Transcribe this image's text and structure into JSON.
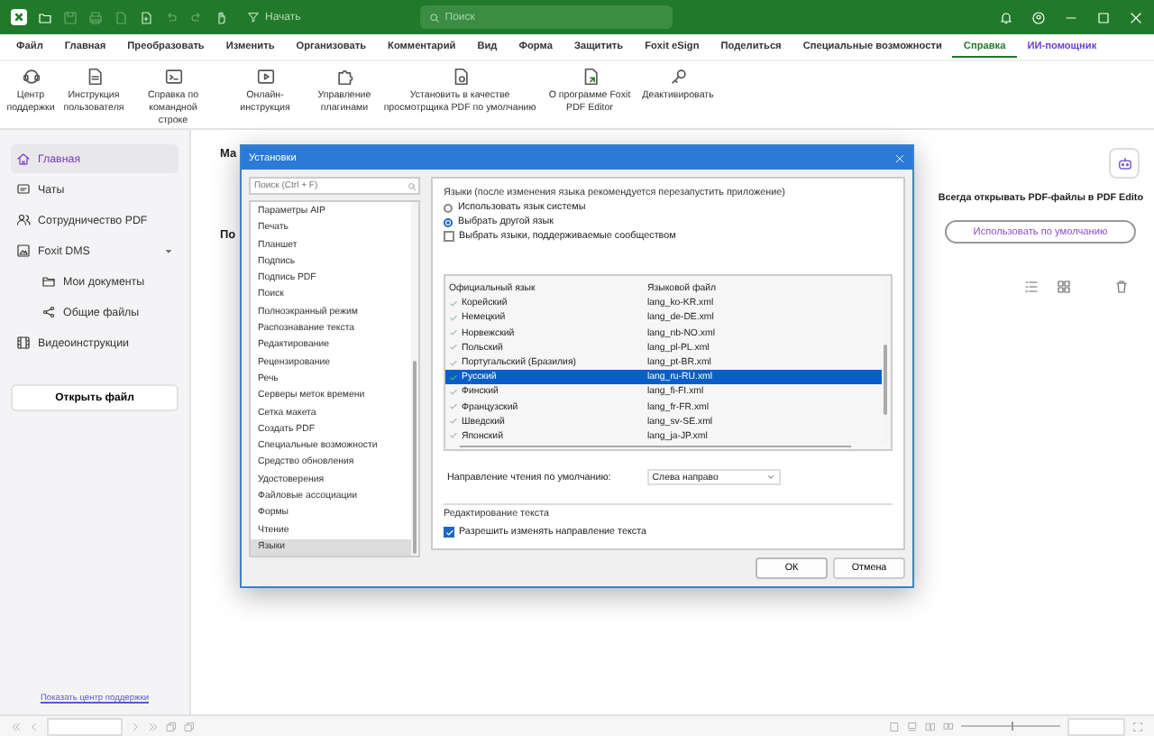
{
  "title_bar": {
    "start_label": "Начать",
    "search": {
      "placeholder": "Поиск"
    }
  },
  "menu_tabs": [
    {
      "label": "Файл",
      "selected": false,
      "kind": "menu"
    },
    {
      "label": "Главная",
      "selected": false,
      "kind": "menu"
    },
    {
      "label": "Преобразовать",
      "selected": false,
      "kind": "menu"
    },
    {
      "label": "Изменить",
      "selected": false,
      "kind": "menu"
    },
    {
      "label": "Организовать",
      "selected": false,
      "kind": "menu"
    },
    {
      "label": "Комментарий",
      "selected": false,
      "kind": "menu"
    },
    {
      "label": "Вид",
      "selected": false,
      "kind": "menu"
    },
    {
      "label": "Форма",
      "selected": false,
      "kind": "menu"
    },
    {
      "label": "Защитить",
      "selected": false,
      "kind": "menu"
    },
    {
      "label": "Foxit eSign",
      "selected": false,
      "kind": "menu"
    },
    {
      "label": "Поделиться",
      "selected": false,
      "kind": "menu"
    },
    {
      "label": "Специальные возможности",
      "selected": false,
      "kind": "menu"
    },
    {
      "label": "Справка",
      "selected": true,
      "kind": "menu"
    },
    {
      "label": "ИИ-помощник",
      "selected": false,
      "kind": "assistant"
    }
  ],
  "ribbon": [
    {
      "label": "Центр поддержки"
    },
    {
      "label": "Инструкция пользователя"
    },
    {
      "label": "Справка по командной строке"
    },
    {
      "label": "Онлайн-инструкция"
    },
    {
      "label": "Управление плагинами"
    },
    {
      "label": "Установить в качестве просмотрщика PDF по умолчанию"
    },
    {
      "label": "О программе Foxit PDF Editor"
    },
    {
      "label": "Деактивировать"
    }
  ],
  "sidebar": {
    "items": [
      {
        "label": "Главная",
        "selected": true
      },
      {
        "label": "Чаты",
        "selected": false
      },
      {
        "label": "Сотрудничество PDF",
        "selected": false
      },
      {
        "label": "Foxit DMS",
        "selected": false,
        "expanded": true,
        "children": [
          {
            "label": "Мои документы",
            "selected": false
          },
          {
            "label": "Общие файлы",
            "selected": false
          }
        ]
      },
      {
        "label": "Видеоинструкции",
        "selected": false
      }
    ],
    "open_button": "Открыть файл",
    "support_link": "Показать центр поддержки"
  },
  "zoom": {
    "level": 0.5
  },
  "main": {
    "heading_1": "Ма",
    "heading_2": "По",
    "default_prompt": "Всегда открывать PDF-файлы в PDF Edito",
    "default_button": "Использовать по умолчанию"
  },
  "dialog": {
    "title": "Установки",
    "search": {
      "placeholder": "Поиск (Ctrl + F)"
    },
    "categories": [
      {
        "label": "Параметры AIP",
        "selected": false
      },
      {
        "label": "Печать",
        "selected": false
      },
      {
        "label": "Планшет",
        "selected": false
      },
      {
        "label": "Подпись",
        "selected": false
      },
      {
        "label": "Подпись PDF",
        "selected": false
      },
      {
        "label": "Поиск",
        "selected": false
      },
      {
        "label": "Полноэкранный режим",
        "selected": false
      },
      {
        "label": "Распознавание текста",
        "selected": false
      },
      {
        "label": "Редактирование",
        "selected": false
      },
      {
        "label": "Рецензирование",
        "selected": false
      },
      {
        "label": "Речь",
        "selected": false
      },
      {
        "label": "Серверы меток времени",
        "selected": false
      },
      {
        "label": "Сетка макета",
        "selected": false
      },
      {
        "label": "Создать PDF",
        "selected": false
      },
      {
        "label": "Специальные возможности",
        "selected": false
      },
      {
        "label": "Средство обновления",
        "selected": false
      },
      {
        "label": "Удостоверения",
        "selected": false
      },
      {
        "label": "Файловые ассоциации",
        "selected": false
      },
      {
        "label": "Формы",
        "selected": false
      },
      {
        "label": "Чтение",
        "selected": false
      },
      {
        "label": "Языки",
        "selected": true
      }
    ],
    "languages_group": {
      "legend": "Языки (после изменения языка рекомендуется перезапустить приложение)",
      "options": [
        {
          "kind": "radio",
          "label": "Использовать язык системы",
          "selected": false
        },
        {
          "kind": "radio",
          "label": "Выбрать другой язык",
          "selected": true
        },
        {
          "kind": "checkbox",
          "label": "Выбрать языки, поддерживаемые сообществом",
          "checked": false
        }
      ],
      "table": {
        "columns": [
          "Официальный язык",
          "Языковой файл"
        ],
        "rows": [
          {
            "language": "Корейский",
            "file": "lang_ko-KR.xml",
            "selected": false
          },
          {
            "language": "Немецкий",
            "file": "lang_de-DE.xml",
            "selected": false
          },
          {
            "language": "Норвежский",
            "file": "lang_nb-NO.xml",
            "selected": false
          },
          {
            "language": "Польский",
            "file": "lang_pl-PL.xml",
            "selected": false
          },
          {
            "language": "Португальский (Бразилия)",
            "file": "lang_pt-BR.xml",
            "selected": false
          },
          {
            "language": "Русский",
            "file": "lang_ru-RU.xml",
            "selected": true
          },
          {
            "language": "Финский",
            "file": "lang_fi-FI.xml",
            "selected": false
          },
          {
            "language": "Французский",
            "file": "lang_fr-FR.xml",
            "selected": false
          },
          {
            "language": "Шведский",
            "file": "lang_sv-SE.xml",
            "selected": false
          },
          {
            "language": "Японский",
            "file": "lang_ja-JP.xml",
            "selected": false
          }
        ]
      },
      "reading_direction": {
        "label": "Направление чтения по умолчанию:",
        "value": "Слева направо"
      }
    },
    "text_editing": {
      "legend": "Редактирование текста",
      "option": {
        "label": "Разрешить изменять направление текста",
        "checked": true
      }
    },
    "buttons": [
      "ОК",
      "Отмена"
    ]
  }
}
